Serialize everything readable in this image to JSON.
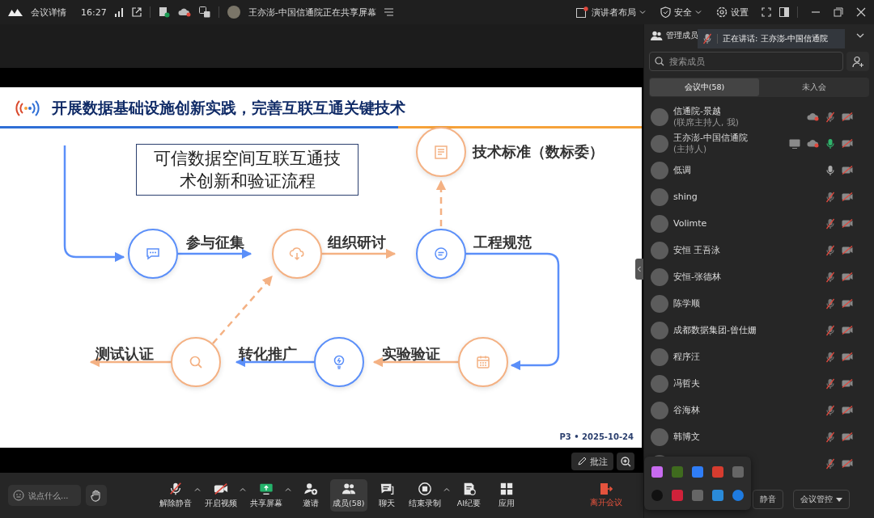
{
  "top_bar": {
    "app_label": "会议详情",
    "time": "16:27",
    "sharing_notice": "王亦澎-中国信通院正在共享屏幕",
    "layout_menu": "演讲者布局",
    "security_menu": "安全",
    "settings": "设置"
  },
  "slide": {
    "title": "开展数据基础设施创新实践，完善互联互通关键技术",
    "caption": "可信数据空间互联互通技术创新和验证流程",
    "steps": [
      {
        "label": "技术标准（数标委）",
        "kind": "document",
        "color": "#f4b183"
      },
      {
        "label": "参与征集",
        "kind": "chat",
        "color": "#5b8ff9"
      },
      {
        "label": "组织研讨",
        "kind": "cloud",
        "color": "#f4b183"
      },
      {
        "label": "工程规范",
        "kind": "message",
        "color": "#5b8ff9"
      },
      {
        "label": "测试认证",
        "kind": "search",
        "color": "#f4b183"
      },
      {
        "label": "转化推广",
        "kind": "bulb",
        "color": "#5b8ff9"
      },
      {
        "label": "实验验证",
        "kind": "calendar",
        "color": "#f4b183"
      }
    ],
    "footer": "P3 • 2025-10-24"
  },
  "annotate_button": "批注",
  "toolbar": {
    "chat_placeholder": "说点什么...",
    "items": [
      {
        "label": "解除静音",
        "kind": "mic-off",
        "has_menu": true,
        "selected": false
      },
      {
        "label": "开启视频",
        "kind": "video-off",
        "has_menu": true,
        "selected": false
      },
      {
        "label": "共享屏幕",
        "kind": "share",
        "has_menu": true,
        "selected": false
      },
      {
        "label": "邀请",
        "kind": "invite",
        "has_menu": false,
        "selected": false
      },
      {
        "label": "成员(58)",
        "kind": "members",
        "has_menu": false,
        "selected": true
      },
      {
        "label": "聊天",
        "kind": "chat",
        "has_menu": false,
        "selected": false
      },
      {
        "label": "结束录制",
        "kind": "record",
        "has_menu": true,
        "selected": false
      },
      {
        "label": "AI纪要",
        "kind": "notes",
        "has_menu": false,
        "selected": false
      },
      {
        "label": "应用",
        "kind": "apps",
        "has_menu": false,
        "selected": false
      }
    ],
    "leave": "离开会议"
  },
  "panel": {
    "title": "管理成员",
    "speaking_tooltip": "正在讲话:  王亦澎-中国信通院",
    "search_placeholder": "搜索成员",
    "tabs": [
      {
        "label": "会议中(58)",
        "selected": true
      },
      {
        "label": "未入会",
        "selected": false
      }
    ],
    "members": [
      {
        "name": "信通院-景越",
        "role": "(联席主持人, 我)",
        "muted": true,
        "speaking": false,
        "video": false,
        "recording": true,
        "sharing": false
      },
      {
        "name": "王亦澎-中国信通院",
        "role": "(主持人)",
        "muted": false,
        "speaking": true,
        "video": false,
        "recording": true,
        "sharing": true
      },
      {
        "name": "低调",
        "muted": false,
        "speaking": false,
        "video": false,
        "recording": false,
        "sharing": false
      },
      {
        "name": "shing",
        "muted": true,
        "speaking": false,
        "video": false,
        "recording": false,
        "sharing": false
      },
      {
        "name": "Volimte",
        "muted": true,
        "speaking": false,
        "video": false,
        "recording": false,
        "sharing": false
      },
      {
        "name": "安恒 王吾泳",
        "muted": true,
        "speaking": false,
        "video": false,
        "recording": false,
        "sharing": false
      },
      {
        "name": "安恒-张德林",
        "muted": true,
        "speaking": false,
        "video": false,
        "recording": false,
        "sharing": false
      },
      {
        "name": "陈学顺",
        "muted": true,
        "speaking": false,
        "video": false,
        "recording": false,
        "sharing": false
      },
      {
        "name": "成都数据集团-曾仕姗",
        "muted": true,
        "speaking": false,
        "video": false,
        "recording": false,
        "sharing": false
      },
      {
        "name": "程序汪",
        "muted": true,
        "speaking": false,
        "video": false,
        "recording": false,
        "sharing": false
      },
      {
        "name": "冯哲夫",
        "muted": true,
        "speaking": false,
        "video": false,
        "recording": false,
        "sharing": false
      },
      {
        "name": "谷海林",
        "muted": true,
        "speaking": false,
        "video": false,
        "recording": false,
        "sharing": false
      },
      {
        "name": "韩博文",
        "muted": true,
        "speaking": false,
        "video": false,
        "recording": false,
        "sharing": false
      },
      {
        "muted": true,
        "speaking": false,
        "video": false,
        "recording": false,
        "sharing": false
      }
    ],
    "buttons": [
      "静音",
      "会议管控"
    ]
  }
}
